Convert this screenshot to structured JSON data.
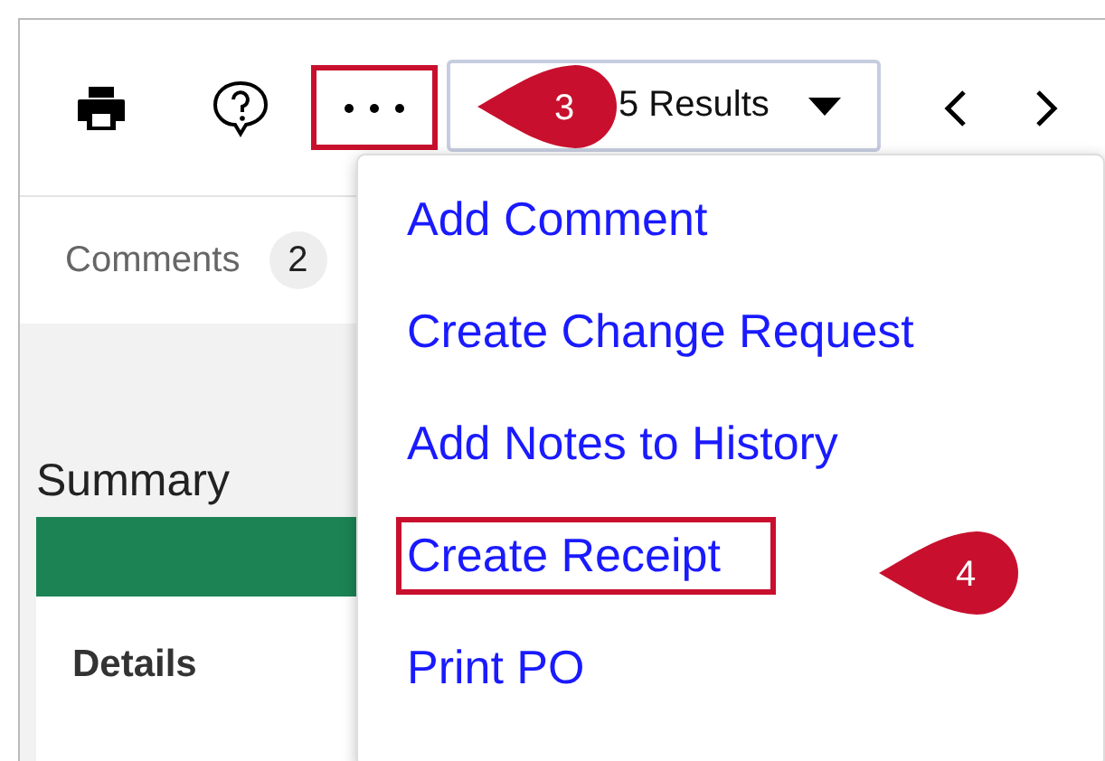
{
  "toolbar": {
    "more_button_annotated": true,
    "results_dropdown": "5 Results"
  },
  "tabs": [
    {
      "label": "Comments",
      "count": "2"
    }
  ],
  "summary": {
    "title": "Summary",
    "details_label": "Details"
  },
  "menu": {
    "items": [
      {
        "label": "Add Comment",
        "annotated": false
      },
      {
        "label": "Create Change Request",
        "annotated": false
      },
      {
        "label": "Add Notes to History",
        "annotated": false
      },
      {
        "label": "Create Receipt",
        "annotated": true
      },
      {
        "label": "Print PO",
        "annotated": false
      }
    ]
  },
  "callouts": [
    {
      "number": "3"
    },
    {
      "number": "4"
    }
  ]
}
